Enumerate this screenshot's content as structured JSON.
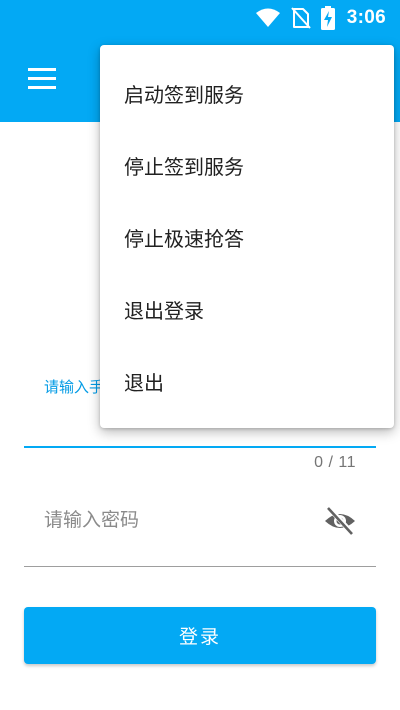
{
  "status_bar": {
    "time": "3:06",
    "icons": [
      "wifi-icon",
      "no-sim-icon",
      "battery-charging-icon"
    ]
  },
  "app_bar": {
    "menu_icon": "hamburger-menu-icon",
    "color": "#03a9f4"
  },
  "dropdown_menu": {
    "items": [
      {
        "label": "启动签到服务"
      },
      {
        "label": "停止签到服务"
      },
      {
        "label": "停止极速抢答"
      },
      {
        "label": "退出登录"
      },
      {
        "label": "退出"
      }
    ]
  },
  "login_form": {
    "phone_label": "请输入手",
    "phone_counter": "0 / 11",
    "password_placeholder": "请输入密码",
    "password_toggle_icon": "eye-off-icon",
    "submit_label": "登录"
  },
  "colors": {
    "primary": "#03a9f4",
    "label_accent": "#039be5",
    "text": "#212121",
    "hint": "#8a8a8a"
  }
}
